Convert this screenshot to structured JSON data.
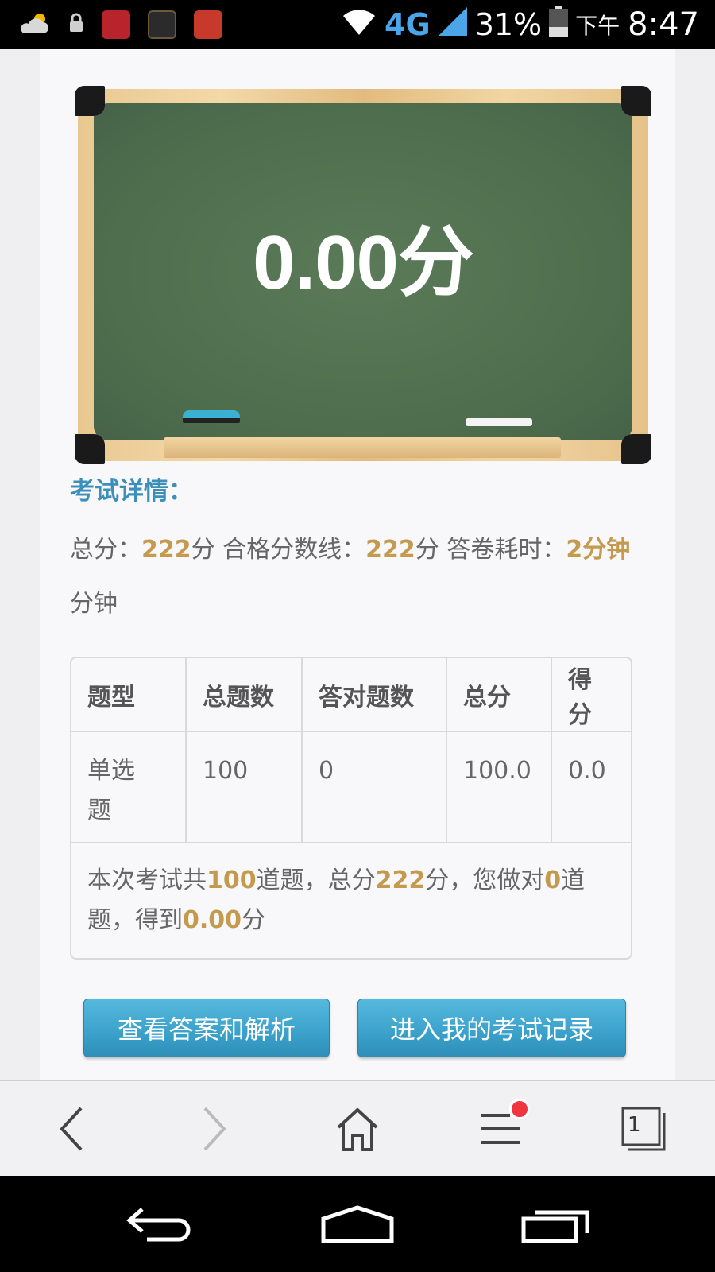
{
  "status_bar": {
    "network": "4G",
    "battery": "31%",
    "ampm": "下午",
    "time": "8:47"
  },
  "board": {
    "score_text": "0.00分"
  },
  "details": {
    "title": "考试详情：",
    "total_label": "总分：",
    "total_value": "222",
    "unit_fen": "分",
    "pass_label": " 合格分数线：",
    "pass_value": "222",
    "time_label": " 答卷耗时：",
    "time_value": "2分钟",
    "time_unit": "分钟"
  },
  "table": {
    "headers": [
      "题型",
      "总题数",
      "答对题数",
      "总分",
      "得分"
    ],
    "rows": [
      [
        "单选题",
        "100",
        "0",
        "100.0",
        "0.0"
      ]
    ],
    "note": {
      "p1": "本次考试共",
      "count": "100",
      "p2": "道题，总分",
      "total": "222",
      "p3": "分，您做对",
      "correct": "0",
      "p4": "道题，得到",
      "score": "0.00",
      "p5": "分"
    }
  },
  "buttons": {
    "view_answers": "查看答案和解析",
    "my_records": "进入我的考试记录"
  },
  "browser": {
    "tabs_count": "1"
  },
  "icons": {
    "weather": "weather-icon",
    "lock": "lock-icon",
    "wifi": "wifi-icon",
    "signal": "signal-icon",
    "battery": "battery-icon",
    "back": "chevron-left-icon",
    "forward": "chevron-right-icon",
    "home": "home-icon",
    "menu": "menu-icon",
    "tabs": "tabs-icon"
  },
  "colors": {
    "accent": "#3b8fb8",
    "highlight": "#c49a4e",
    "button": "#3aa1ca",
    "badge": "#f0353f"
  }
}
